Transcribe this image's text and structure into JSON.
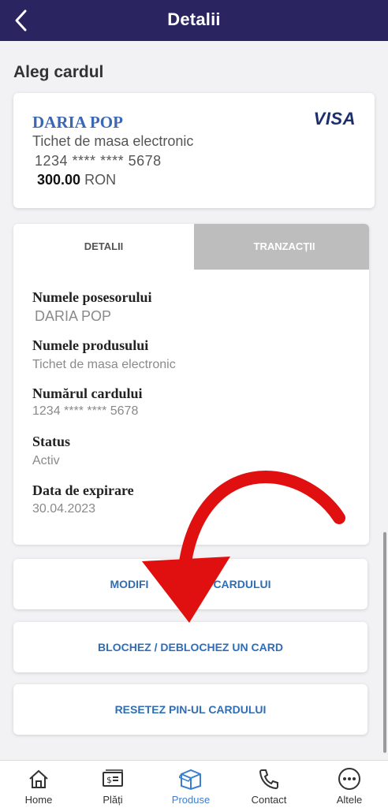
{
  "header": {
    "title": "Detalii",
    "back_icon": "chevron-left-icon"
  },
  "section_title": "Aleg cardul",
  "card": {
    "holder": "DARIA POP",
    "brand": "VISA",
    "product": "Tichet de masa electronic",
    "number": "1234 **** **** 5678",
    "balance_amount": "300.00",
    "balance_currency": "RON"
  },
  "tabs": [
    {
      "label": "DETALII",
      "active": true
    },
    {
      "label": "TRANZACȚII",
      "active": false
    }
  ],
  "fields": [
    {
      "label": "Numele posesorului",
      "value": "DARIA POP"
    },
    {
      "label": "Numele produsului",
      "value": "Tichet de masa electronic"
    },
    {
      "label": "Numărul cardului",
      "value": "1234 **** **** 5678"
    },
    {
      "label": "Status",
      "value": "Activ"
    },
    {
      "label": "Data de expirare",
      "value": "30.04.2023"
    }
  ],
  "actions": {
    "modify_label": "MODIFI",
    "modify_label_tail": "CARDULUI",
    "block_label": "BLOCHEZ / DEBLOCHEZ UN CARD",
    "reset_label": "RESETEZ PIN-UL CARDULUI"
  },
  "bottom_nav": [
    {
      "label": "Home",
      "icon": "home-icon",
      "active": false
    },
    {
      "label": "Plăți",
      "icon": "payments-icon",
      "active": false
    },
    {
      "label": "Produse",
      "icon": "box-icon",
      "active": true
    },
    {
      "label": "Contact",
      "icon": "phone-icon",
      "active": false
    },
    {
      "label": "Altele",
      "icon": "more-icon",
      "active": false
    }
  ],
  "colors": {
    "header_bg": "#2a2560",
    "accent": "#2f6db5",
    "arrow": "#e01010"
  }
}
